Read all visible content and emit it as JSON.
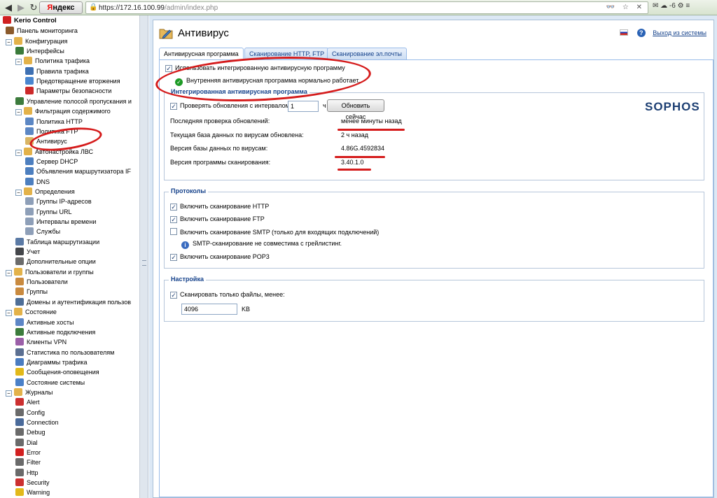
{
  "browser": {
    "back": "◀",
    "forward": "▶",
    "reload": "↻",
    "yandex_first": "Я",
    "yandex_rest": "ндекс",
    "url_host": "https://172.16.100.99",
    "url_path": "/admin/index.php",
    "url_icons": "👓 ☆ ✕",
    "right_extra": "✉ ☁ -6 ⚙ ≡"
  },
  "tree": [
    {
      "label": "Kerio Control",
      "icon": "kerio-logo-icon",
      "color": "#d02020",
      "bold": true
    },
    {
      "label": "Панель мониторинга",
      "icon": "dashboard-icon",
      "color": "#8b5a2b"
    },
    {
      "label": "Конфигурация",
      "icon": "folder-icon",
      "color": "#e3b24a",
      "toggle": "−"
    },
    {
      "label": "Интерфейсы",
      "icon": "interfaces-icon",
      "color": "#3a7a3a"
    },
    {
      "label": "Политика трафика",
      "icon": "folder-icon",
      "color": "#e3b24a",
      "toggle": "−"
    },
    {
      "label": "Правила трафика",
      "icon": "traffic-rules-icon",
      "color": "#3e70b3"
    },
    {
      "label": "Предотвращение вторжения",
      "icon": "shield-icon",
      "color": "#4a86cf"
    },
    {
      "label": "Параметры безопасности",
      "icon": "security-params-icon",
      "color": "#cc2a2a"
    },
    {
      "label": "Управление полосой пропускания и",
      "icon": "bandwidth-icon",
      "color": "#3c7b3c"
    },
    {
      "label": "Фильтрация содержимого",
      "icon": "folder-icon",
      "color": "#e3b24a",
      "toggle": "−"
    },
    {
      "label": "Политика HTTP",
      "icon": "http-policy-icon",
      "color": "#5c87c4"
    },
    {
      "label": "Политика FTP",
      "icon": "ftp-policy-icon",
      "color": "#5c87c4"
    },
    {
      "label": "Антивирус",
      "icon": "antivirus-icon",
      "color": "#d9b563",
      "selected": true
    },
    {
      "label": "Автонастройка ЛВС",
      "icon": "folder-icon",
      "color": "#e3b24a",
      "toggle": "−"
    },
    {
      "label": "Сервер DHCP",
      "icon": "dhcp-icon",
      "color": "#4d7fbf"
    },
    {
      "label": "Объявления маршрутизатора IF",
      "icon": "router-adv-icon",
      "color": "#4d7fbf"
    },
    {
      "label": "DNS",
      "icon": "dns-icon",
      "color": "#4d7fbf"
    },
    {
      "label": "Определения",
      "icon": "folder-icon",
      "color": "#e3b24a",
      "toggle": "−"
    },
    {
      "label": "Группы IP-адресов",
      "icon": "ip-groups-icon",
      "color": "#8e9fb8"
    },
    {
      "label": "Группы URL",
      "icon": "url-groups-icon",
      "color": "#8e9fb8"
    },
    {
      "label": "Интервалы времени",
      "icon": "time-intervals-icon",
      "color": "#8e9fb8"
    },
    {
      "label": "Службы",
      "icon": "services-icon",
      "color": "#8e9fb8"
    },
    {
      "label": "Таблица маршрутизации",
      "icon": "routing-table-icon",
      "color": "#5b7aa5"
    },
    {
      "label": "Учет",
      "icon": "accounting-icon",
      "color": "#44464a"
    },
    {
      "label": "Дополнительные опции",
      "icon": "advanced-options-icon",
      "color": "#6b6b6b"
    },
    {
      "label": "Пользователи и группы",
      "icon": "folder-icon",
      "color": "#e3b24a",
      "toggle": "−"
    },
    {
      "label": "Пользователи",
      "icon": "user-icon",
      "color": "#c98a3f"
    },
    {
      "label": "Группы",
      "icon": "group-icon",
      "color": "#c98a3f"
    },
    {
      "label": "Домены и аутентификация пользов",
      "icon": "domains-icon",
      "color": "#4e6e97"
    },
    {
      "label": "Состояние",
      "icon": "folder-icon",
      "color": "#e3b24a",
      "toggle": "−"
    },
    {
      "label": "Активные хосты",
      "icon": "active-hosts-icon",
      "color": "#5d86c6"
    },
    {
      "label": "Активные подключения",
      "icon": "active-connections-icon",
      "color": "#3c7b3c"
    },
    {
      "label": "Клиенты VPN",
      "icon": "vpn-clients-icon",
      "color": "#9b5fa8"
    },
    {
      "label": "Статистика по пользователям",
      "icon": "user-stats-icon",
      "color": "#5b6f91"
    },
    {
      "label": "Диаграммы трафика",
      "icon": "traffic-charts-icon",
      "color": "#4a7cc0"
    },
    {
      "label": "Сообщения-оповещения",
      "icon": "warning-icon",
      "color": "#e2b91a"
    },
    {
      "label": "Состояние системы",
      "icon": "system-status-icon",
      "color": "#4a80c8"
    },
    {
      "label": "Журналы",
      "icon": "folder-icon",
      "color": "#e3b24a",
      "toggle": "−"
    },
    {
      "label": "Alert",
      "icon": "log-alert-icon",
      "color": "#cc3030"
    },
    {
      "label": "Config",
      "icon": "log-config-icon",
      "color": "#6a6a6a"
    },
    {
      "label": "Connection",
      "icon": "log-connection-icon",
      "color": "#4a6a9a"
    },
    {
      "label": "Debug",
      "icon": "log-debug-icon",
      "color": "#6a6a6a"
    },
    {
      "label": "Dial",
      "icon": "log-dial-icon",
      "color": "#6a6a6a"
    },
    {
      "label": "Error",
      "icon": "log-error-icon",
      "color": "#d22020"
    },
    {
      "label": "Filter",
      "icon": "log-filter-icon",
      "color": "#6a6a6a"
    },
    {
      "label": "Http",
      "icon": "log-http-icon",
      "color": "#6a6a6a"
    },
    {
      "label": "Security",
      "icon": "log-security-icon",
      "color": "#cc3030"
    },
    {
      "label": "Warning",
      "icon": "log-warning-icon",
      "color": "#e2b91a"
    }
  ],
  "header": {
    "title": "Антивирус",
    "logout": "Выход из системы",
    "help": "?"
  },
  "tabs": [
    {
      "label": "Антивирусная программа",
      "active": true
    },
    {
      "label": "Сканирование HTTP, FTP",
      "active": false
    },
    {
      "label": "Сканирование эл.почты",
      "active": false
    }
  ],
  "antivirus": {
    "use_integrated_label": "Использовать интегрированную антивирусную программу",
    "use_integrated_checked": true,
    "status_text": "Внутренняя антивирусная программа нормально работает.",
    "ok_mark": "✓",
    "integrated_legend": "Интегрированная антивирусная программа",
    "check_updates_label": "Проверять обновления с интервалом",
    "check_updates_checked": true,
    "interval_value": "1",
    "interval_unit": "ч",
    "update_now_button": "Обновить сейчас",
    "last_check_label": "Последняя проверка обновлений:",
    "last_check_value": "менее минуты назад",
    "db_updated_label": "Текущая база данных по вирусам обновлена:",
    "db_updated_value": "2 ч назад",
    "db_version_label": "Версия базы данных по вирусам:",
    "db_version_value": "4.86G.4592834",
    "engine_version_label": "Версия программы сканирования:",
    "engine_version_value": "3.40.1.0",
    "vendor_logo": "SOPHOS"
  },
  "protocols": {
    "legend": "Протоколы",
    "items": [
      {
        "label": "Включить сканирование HTTP",
        "checked": true
      },
      {
        "label": "Включить сканирование FTP",
        "checked": true
      },
      {
        "label": "Включить сканирование SMTP (только для входящих подключений)",
        "checked": false
      },
      {
        "label": "Включить сканирование POP3",
        "checked": true
      }
    ],
    "smtp_note": "SMTP-сканирование не совместима с грейлистинг.",
    "info_mark": "i"
  },
  "settings": {
    "legend": "Настройка",
    "scan_smaller_label": "Сканировать только файлы, менее:",
    "scan_smaller_checked": true,
    "size_value": "4096",
    "size_unit": "KB"
  },
  "colors": {
    "accent": "#15428b",
    "annotation_red": "#d51b1b"
  }
}
